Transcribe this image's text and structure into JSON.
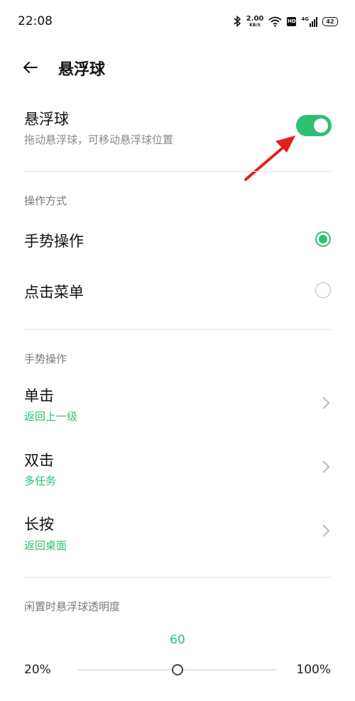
{
  "status_bar": {
    "time": "22:08",
    "net_speed_value": "2.00",
    "net_speed_unit": "KB/S",
    "hd_badge": "HD",
    "network_type": "4G",
    "battery_level": "42",
    "icons": [
      "bluetooth-icon",
      "wifi-icon",
      "hd-icon",
      "signal-icon",
      "battery-icon"
    ]
  },
  "header": {
    "back_icon": "arrow-left-icon",
    "title": "悬浮球"
  },
  "floating_ball": {
    "title": "悬浮球",
    "subtitle": "拖动悬浮球，可移动悬浮球位置",
    "enabled": true
  },
  "operation_mode": {
    "section_label": "操作方式",
    "options": [
      {
        "label": "手势操作",
        "selected": true
      },
      {
        "label": "点击菜单",
        "selected": false
      }
    ]
  },
  "gestures": {
    "section_label": "手势操作",
    "items": [
      {
        "label": "单击",
        "value": "返回上一级"
      },
      {
        "label": "双击",
        "value": "多任务"
      },
      {
        "label": "长按",
        "value": "返回桌面"
      }
    ]
  },
  "opacity": {
    "section_label": "闲置时悬浮球透明度",
    "current_value": "60",
    "min_label": "20%",
    "max_label": "100%",
    "value_fraction": 0.5
  },
  "colors": {
    "accent": "#2fbf71",
    "annotation": "#e02020",
    "divider": "#e6e6e6"
  }
}
